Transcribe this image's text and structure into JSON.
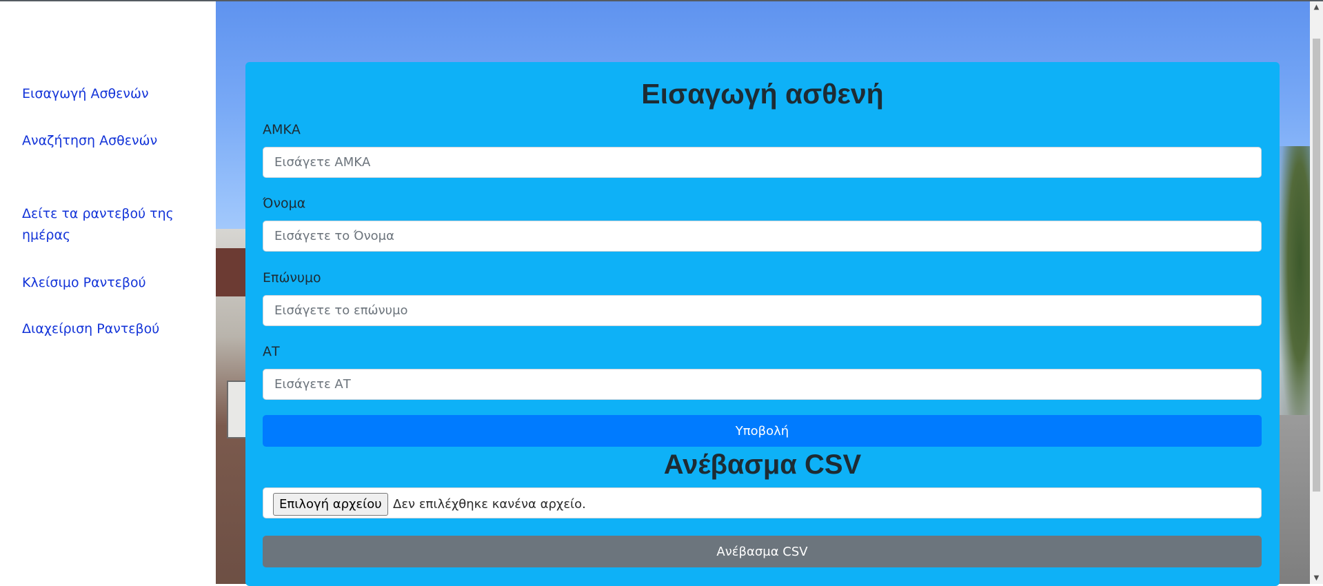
{
  "sidebar": {
    "items": [
      {
        "label": "Εισαγωγή Ασθενών"
      },
      {
        "label": "Αναζήτηση Ασθενών"
      },
      {
        "label": "Δείτε τα ραντεβού της ημέρας"
      },
      {
        "label": "Κλείσιμο Ραντεβού"
      },
      {
        "label": "Διαχείριση Ραντεβού"
      }
    ]
  },
  "form": {
    "title": "Εισαγωγή ασθενή",
    "fields": [
      {
        "label": "ΑΜΚΑ",
        "placeholder": "Εισάγετε ΑΜΚΑ",
        "value": ""
      },
      {
        "label": "Όνομα",
        "placeholder": "Εισάγετε το Όνομα",
        "value": ""
      },
      {
        "label": "Επώνυμο",
        "placeholder": "Εισάγετε το επώνυμο",
        "value": ""
      },
      {
        "label": "ΑΤ",
        "placeholder": "Εισάγετε ΑΤ",
        "value": ""
      }
    ],
    "submit_label": "Υποβολή"
  },
  "csv": {
    "title": "Ανέβασμα CSV",
    "file_button_label": "Επιλογή αρχείου",
    "file_status": "Δεν επιλέχθηκε κανένα αρχείο.",
    "upload_label": "Ανέβασμα CSV"
  },
  "colors": {
    "card": "#0eb1f7",
    "primary": "#007bff",
    "secondary": "#6c757d",
    "link": "#1233d8"
  },
  "icons": {
    "scroll_up": "scroll-up-arrow-icon",
    "scroll_down": "scroll-down-arrow-icon"
  }
}
